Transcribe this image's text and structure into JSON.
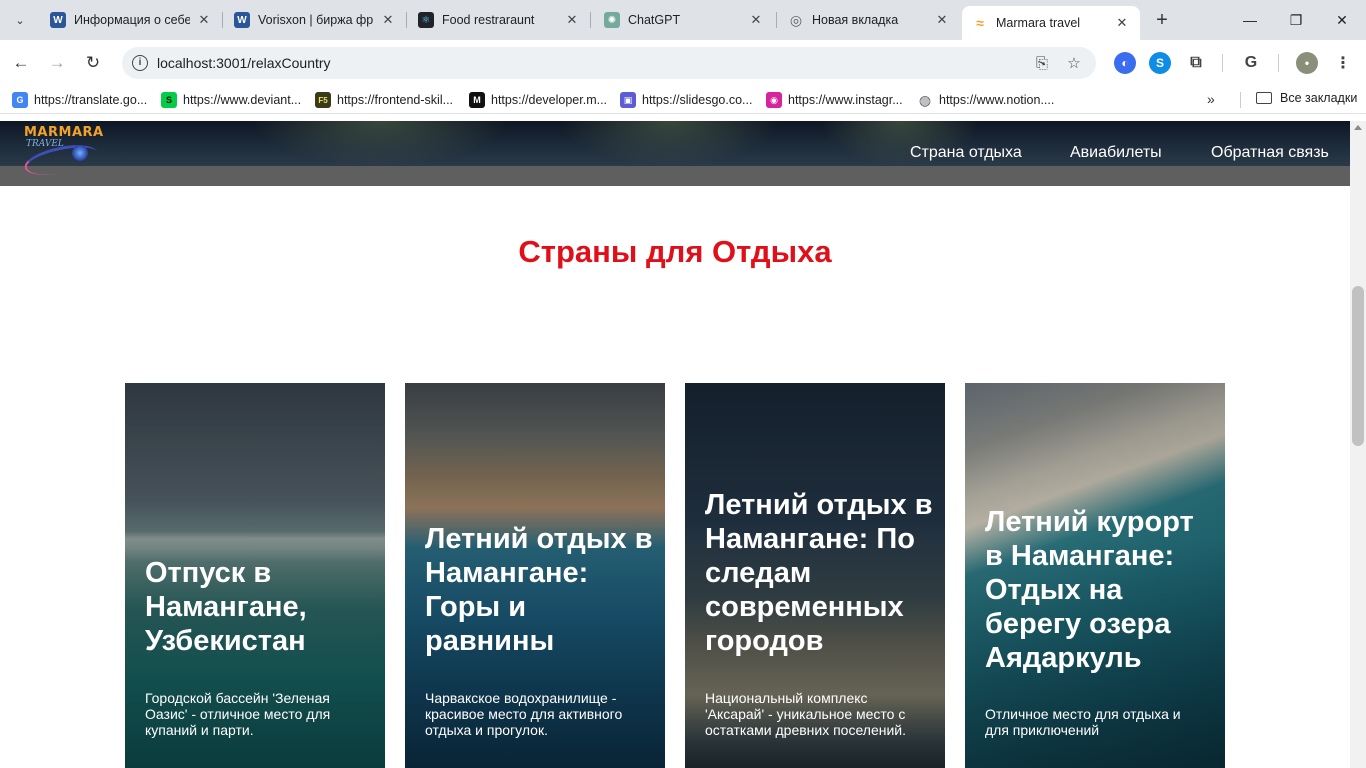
{
  "browser": {
    "tabs": [
      {
        "title": "Информация о себе",
        "icon": "word-icon",
        "color": "#2b579a",
        "glyph": "W"
      },
      {
        "title": "Vorisxon | биржа фри",
        "icon": "word-icon",
        "color": "#2b579a",
        "glyph": "W"
      },
      {
        "title": "Food restraraunt",
        "icon": "react-icon",
        "color": "#20232a",
        "glyph": "⚛"
      },
      {
        "title": "ChatGPT",
        "icon": "chatgpt-icon",
        "color": "#74aa9c",
        "glyph": "✺"
      },
      {
        "title": "Новая вкладка",
        "icon": "chrome-icon",
        "color": "#5f6368",
        "glyph": "◎"
      },
      {
        "title": "Marmara travel",
        "icon": "marmara-icon",
        "color": "#f4a22a",
        "glyph": "≈"
      }
    ],
    "url": "localhost:3001/relaxCountry",
    "bookmarks": [
      {
        "label": "https://translate.go...",
        "icon": "google-translate-icon",
        "color": "#4285f4",
        "glyph": "G"
      },
      {
        "label": "https://www.deviant...",
        "icon": "deviantart-icon",
        "color": "#05cc47",
        "glyph": "S"
      },
      {
        "label": "https://frontend-skil...",
        "icon": "frontend-skills-icon",
        "color": "#3a3a1a",
        "glyph": "F5"
      },
      {
        "label": "https://developer.m...",
        "icon": "mdn-icon",
        "color": "#111111",
        "glyph": "M"
      },
      {
        "label": "https://slidesgo.co...",
        "icon": "slidesgo-icon",
        "color": "#5e5bd6",
        "glyph": "▣"
      },
      {
        "label": "https://www.instagr...",
        "icon": "instagram-icon",
        "color": "#d6249f",
        "glyph": "◉"
      },
      {
        "label": "https://www.notion....",
        "icon": "globe-icon",
        "color": "#5f6368",
        "glyph": "◍"
      }
    ],
    "all_bookmarks": "Все закладки"
  },
  "site": {
    "logo_line1": "MARMARA",
    "logo_line2": "TRAVEL",
    "nav": [
      "Страна отдыха",
      "Авиабилеты",
      "Обратная связь"
    ],
    "page_title": "Страны для Отдыха",
    "accent": "#e0101a"
  },
  "cards": [
    {
      "title": "Отпуск в Намангане, Узбекистан",
      "desc": "Городской бассейн 'Зеленая Оазис' - отличное место для купаний и парти."
    },
    {
      "title": "Летний отдых в Намангане: Горы и равнины",
      "desc": "Чарвакское водохранилище - красивое место для активного отдыха и прогулок."
    },
    {
      "title": "Летний отдых в Намангане: По следам современных городов",
      "desc": "Национальный комплекс 'Аксарай' - уникальное место с остатками древних поселений."
    },
    {
      "title": "Летний курорт в Намангане: Отдых на берегу озера Аядаркуль",
      "desc": "Отличное место для отдыха и для приключений"
    }
  ]
}
